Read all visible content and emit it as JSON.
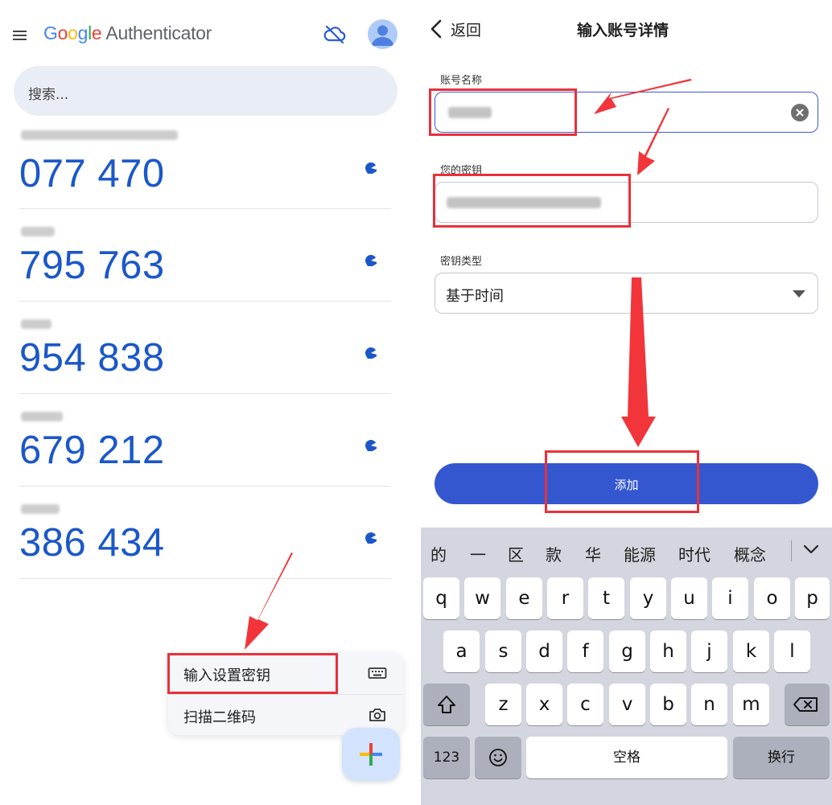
{
  "left_panel": {
    "app_title": {
      "google_letters": [
        "G",
        "o",
        "o",
        "g",
        "l",
        "e"
      ],
      "word": "Authenticator"
    },
    "search": {
      "placeholder": "搜索..."
    },
    "codes": [
      {
        "code": "077 470"
      },
      {
        "code": "795 763"
      },
      {
        "code": "954 838"
      },
      {
        "code": "679 212"
      },
      {
        "code": "386 434"
      }
    ],
    "popup_menu": {
      "items": [
        {
          "label": "输入设置密钥",
          "icon": "keyboard-icon"
        },
        {
          "label": "扫描二维码",
          "icon": "camera-icon"
        }
      ]
    },
    "fab_icon": "plus-icon",
    "colors": {
      "code_blue": "#1b57c9",
      "fab_bg": "#d3e3fd"
    }
  },
  "right_panel": {
    "nav": {
      "back_label": "返回",
      "title": "输入账号详情"
    },
    "form": {
      "account_name_label": "账号名称",
      "secret_key_label": "您的密钥",
      "key_type_label": "密钥类型",
      "key_type_value": "基于时间"
    },
    "add_button_label": "添加",
    "keyboard": {
      "candidates": [
        "的",
        "一",
        "区",
        "款",
        "华",
        "能源",
        "时代",
        "概念"
      ],
      "row1": [
        "q",
        "w",
        "e",
        "r",
        "t",
        "y",
        "u",
        "i",
        "o",
        "p"
      ],
      "row2": [
        "a",
        "s",
        "d",
        "f",
        "g",
        "h",
        "j",
        "k",
        "l"
      ],
      "row3": [
        "z",
        "x",
        "c",
        "v",
        "b",
        "n",
        "m"
      ],
      "bottom": {
        "numbers": "123",
        "space": "空格",
        "return": "换行"
      }
    },
    "colors": {
      "accent": "#3457d0",
      "highlight": "#e8313a"
    }
  }
}
